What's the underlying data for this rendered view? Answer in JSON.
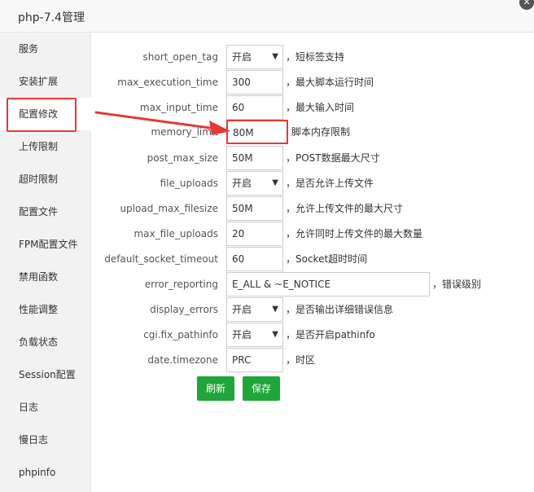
{
  "window": {
    "title": "php-7.4管理",
    "close_glyph": "✕"
  },
  "sidebar": {
    "items": [
      {
        "label": "服务"
      },
      {
        "label": "安装扩展"
      },
      {
        "label": "配置修改"
      },
      {
        "label": "上传限制"
      },
      {
        "label": "超时限制"
      },
      {
        "label": "配置文件"
      },
      {
        "label": "FPM配置文件"
      },
      {
        "label": "禁用函数"
      },
      {
        "label": "性能调整"
      },
      {
        "label": "负载状态"
      },
      {
        "label": "Session配置"
      },
      {
        "label": "日志"
      },
      {
        "label": "慢日志"
      },
      {
        "label": "phpinfo"
      }
    ],
    "active_index": 2
  },
  "form": {
    "rows": [
      {
        "name": "short_open_tag",
        "type": "select",
        "value": "开启",
        "desc": "，短标签支持"
      },
      {
        "name": "max_execution_time",
        "type": "input",
        "value": "300",
        "desc": "，最大脚本运行时间"
      },
      {
        "name": "max_input_time",
        "type": "input",
        "value": "60",
        "desc": "，最大输入时间"
      },
      {
        "name": "memory_limit",
        "type": "input",
        "value": "80M",
        "desc": "脚本内存限制"
      },
      {
        "name": "post_max_size",
        "type": "input",
        "value": "50M",
        "desc": "，POST数据最大尺寸"
      },
      {
        "name": "file_uploads",
        "type": "select",
        "value": "开启",
        "desc": "，是否允许上传文件"
      },
      {
        "name": "upload_max_filesize",
        "type": "input",
        "value": "50M",
        "desc": "，允许上传文件的最大尺寸"
      },
      {
        "name": "max_file_uploads",
        "type": "input",
        "value": "20",
        "desc": "，允许同时上传文件的最大数量"
      },
      {
        "name": "default_socket_timeout",
        "type": "input",
        "value": "60",
        "desc": "，Socket超时时间"
      },
      {
        "name": "error_reporting",
        "type": "input-wide",
        "value": "E_ALL & ~E_NOTICE",
        "desc": "，错误级别"
      },
      {
        "name": "display_errors",
        "type": "select",
        "value": "开启",
        "desc": "，是否输出详细错误信息"
      },
      {
        "name": "cgi.fix_pathinfo",
        "type": "select",
        "value": "开启",
        "desc": "，是否开启pathinfo"
      },
      {
        "name": "date.timezone",
        "type": "input",
        "value": "PRC",
        "desc": "，时区"
      }
    ]
  },
  "buttons": {
    "refresh_label": "刷新",
    "save_label": "保存"
  },
  "colors": {
    "accent_green": "#20a53a",
    "annotation_red": "#e53935"
  },
  "icons": {
    "select_chevron": "chevron-down-icon",
    "close": "close-icon"
  }
}
